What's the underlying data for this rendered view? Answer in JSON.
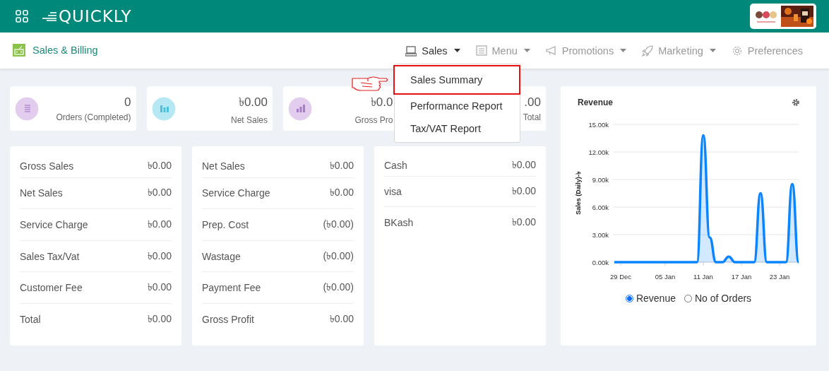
{
  "header": {
    "logo_text": "QUICKLY"
  },
  "module": {
    "title": "Sales & Billing"
  },
  "nav": [
    {
      "label": "Sales",
      "caret": true,
      "selected": true
    },
    {
      "label": "Menu",
      "caret": true,
      "selected": false
    },
    {
      "label": "Promotions",
      "caret": true,
      "selected": false
    },
    {
      "label": "Marketing",
      "caret": true,
      "selected": false
    },
    {
      "label": "Preferences",
      "caret": false,
      "selected": false
    }
  ],
  "dropdown": {
    "items": [
      {
        "label": "Sales Summary",
        "selected": true
      },
      {
        "label": "Performance Report",
        "selected": false
      },
      {
        "label": "Tax/VAT Report",
        "selected": false
      }
    ]
  },
  "stats": [
    {
      "value": "0",
      "label": "Orders (Completed)",
      "color": "#e3cdef"
    },
    {
      "value": "৳0.00",
      "label": "Net Sales",
      "color": "#b5e8f2"
    },
    {
      "value": "৳0.0",
      "label": "Gross Pro",
      "color": "#e3cdef"
    },
    {
      "value": ".00",
      "label": "Total"
    }
  ],
  "panels": [
    {
      "rows": [
        {
          "label": "Gross Sales",
          "value": "৳0.00"
        },
        {
          "label": "Net Sales",
          "value": "৳0.00"
        },
        {
          "label": "Service Charge",
          "value": "৳0.00"
        },
        {
          "label": "Sales Tax/Vat",
          "value": "৳0.00"
        },
        {
          "label": "Customer Fee",
          "value": "৳0.00"
        },
        {
          "label": "Total",
          "value": "৳0.00"
        }
      ]
    },
    {
      "rows": [
        {
          "label": "Net Sales",
          "value": "৳0.00"
        },
        {
          "label": "Service Charge",
          "value": "৳0.00"
        },
        {
          "label": "Prep. Cost",
          "value": "(৳0.00)"
        },
        {
          "label": "Wastage",
          "value": "(৳0.00)"
        },
        {
          "label": "Payment Fee",
          "value": "(৳0.00)"
        },
        {
          "label": "Gross Profit",
          "value": "৳0.00"
        }
      ]
    },
    {
      "rows": [
        {
          "label": "Cash",
          "value": "৳0.00"
        },
        {
          "label": "visa",
          "value": "৳0.00"
        },
        {
          "label": "BKash",
          "value": "৳0.00"
        }
      ]
    }
  ],
  "chart_panel": {
    "title": "Revenue",
    "chart_data": {
      "type": "area",
      "ylabel": "Sales (Daily)-৳",
      "grid": true,
      "categories": [
        null,
        "29 Dec",
        null,
        null,
        null,
        null,
        null,
        null,
        "05 Jan",
        null,
        null,
        null,
        null,
        null,
        "11 Jan",
        null,
        null,
        null,
        null,
        null,
        "17 Jan",
        null,
        null,
        null,
        null,
        null,
        "23 Jan",
        null,
        null,
        null
      ],
      "series": [
        {
          "color": "#0a84ff",
          "values": [
            0,
            0,
            0,
            0,
            0,
            0,
            0,
            0,
            0,
            0,
            0,
            0,
            0,
            0,
            13800,
            2700,
            0,
            0,
            600,
            0,
            0,
            0,
            0,
            7500,
            0,
            0,
            0,
            0,
            8500,
            0
          ]
        }
      ],
      "ylim": [
        0,
        15000
      ],
      "yticks": [
        {
          "value": 0,
          "label": "0.00k"
        },
        {
          "value": 3000,
          "label": "3.00k"
        },
        {
          "value": 6000,
          "label": "6.00k"
        },
        {
          "value": 9000,
          "label": "9.00k"
        },
        {
          "value": 12000,
          "label": "12.00k"
        },
        {
          "value": 15000,
          "label": "15.00k"
        }
      ]
    },
    "options": [
      {
        "label": "Revenue",
        "selected": true
      },
      {
        "label": "No of Orders",
        "selected": false
      }
    ]
  }
}
